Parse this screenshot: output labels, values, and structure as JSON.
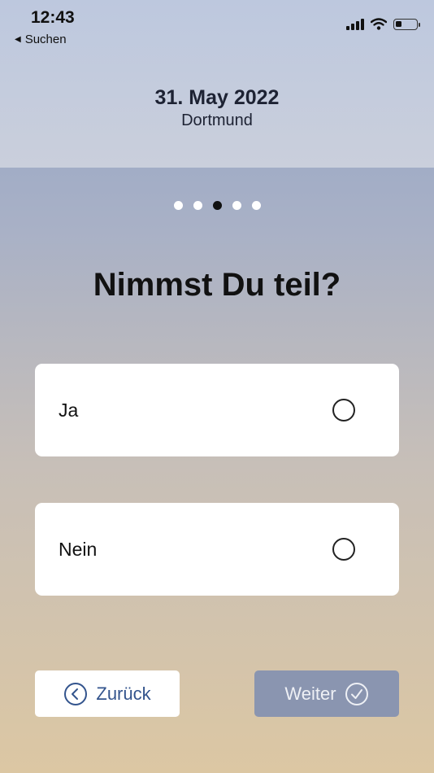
{
  "status_bar": {
    "time": "12:43",
    "back_label": "Suchen",
    "back_icon": "back-triangle-icon",
    "signal_icon": "cellular-signal-icon",
    "wifi_icon": "wifi-icon",
    "battery_icon": "battery-icon",
    "battery_level": 0.3
  },
  "header": {
    "date": "31. May 2022",
    "location": "Dortmund"
  },
  "progress": {
    "total_steps": 5,
    "current_step": 3
  },
  "question": "Nimmst Du teil?",
  "options": [
    {
      "label": "Ja",
      "selected": false
    },
    {
      "label": "Nein",
      "selected": false
    }
  ],
  "buttons": {
    "back_label": "Zurück",
    "back_icon": "chevron-left-circle-icon",
    "next_label": "Weiter",
    "next_icon": "checkmark-circle-icon",
    "next_enabled": false
  },
  "colors": {
    "accent": "#33548d",
    "disabled_button": "#8a95b0",
    "header_bg": "#c4ccdd"
  }
}
